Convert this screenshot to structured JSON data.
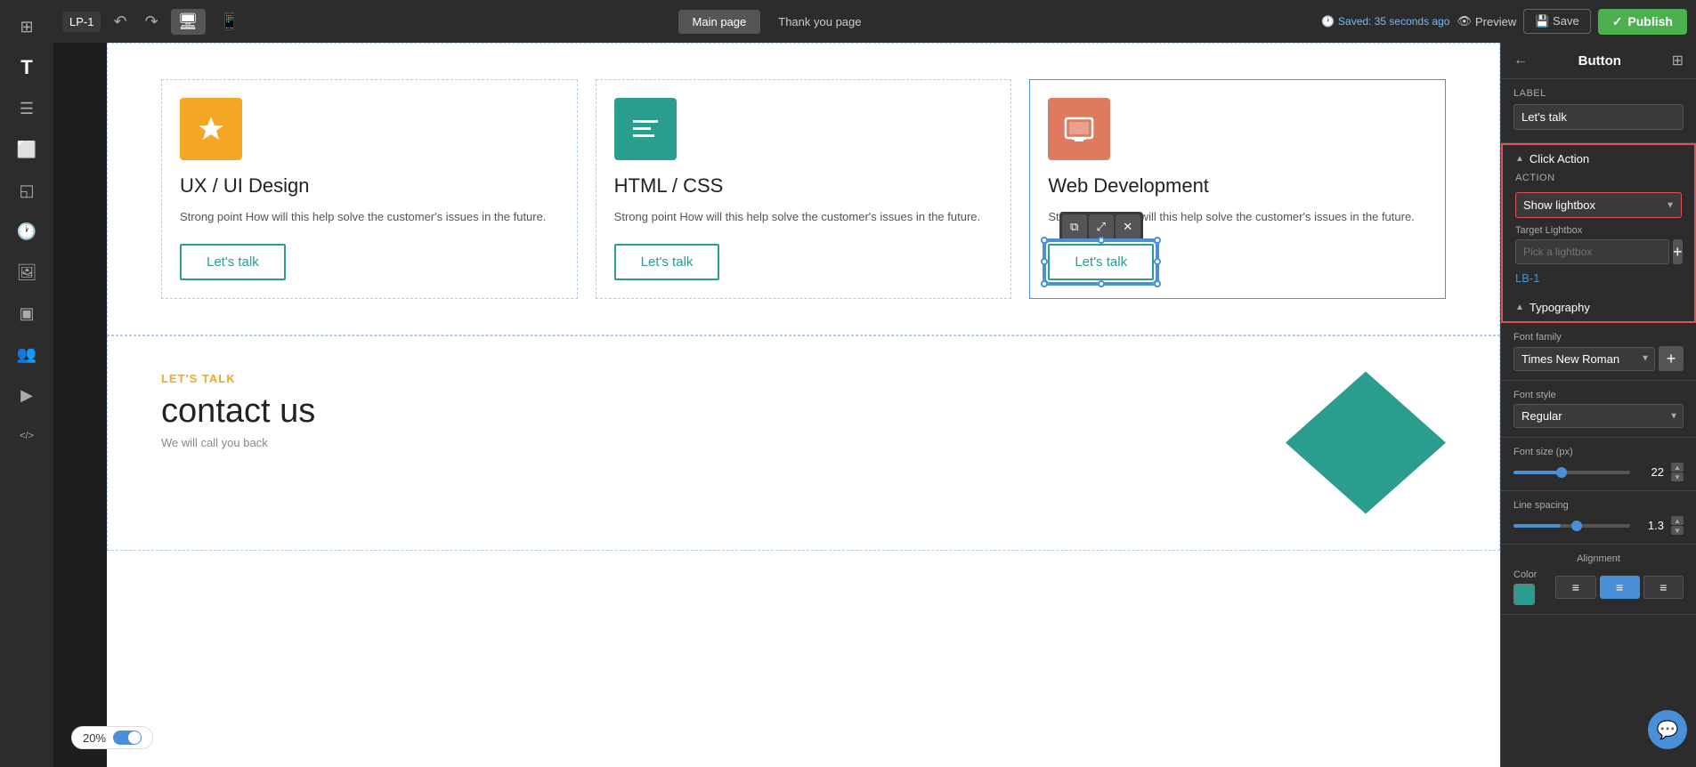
{
  "topbar": {
    "project_name": "LP-1",
    "undo_label": "↺",
    "redo_label": "↻",
    "desktop_icon": "🖥",
    "mobile_icon": "📱",
    "pages": [
      {
        "label": "Main page",
        "active": true
      },
      {
        "label": "Thank you page",
        "active": false
      }
    ],
    "saved_text": "Saved: 35 seconds ago",
    "preview_label": "Preview",
    "save_label": "Save",
    "publish_label": "Publish"
  },
  "left_sidebar": {
    "icons": [
      {
        "name": "home-icon",
        "symbol": "⊞"
      },
      {
        "name": "text-icon",
        "symbol": "T"
      },
      {
        "name": "rows-icon",
        "symbol": "☰"
      },
      {
        "name": "widget-icon",
        "symbol": "⬜"
      },
      {
        "name": "shape-icon",
        "symbol": "◱"
      },
      {
        "name": "clock-icon",
        "symbol": "🕐"
      },
      {
        "name": "image-icon",
        "symbol": "🖼"
      },
      {
        "name": "section-icon",
        "symbol": "▣"
      },
      {
        "name": "team-icon",
        "symbol": "👥"
      },
      {
        "name": "video-icon",
        "symbol": "▶"
      },
      {
        "name": "code-icon",
        "symbol": "</>"
      }
    ]
  },
  "canvas": {
    "services": [
      {
        "icon_symbol": "✦",
        "icon_color": "orange",
        "title": "UX / UI Design",
        "description": "Strong point How will this help solve the customer's issues in the future.",
        "button_label": "Let's talk",
        "selected": false
      },
      {
        "icon_symbol": "⌨",
        "icon_color": "teal",
        "title": "HTML / CSS",
        "description": "Strong point How will this help solve the customer's issues in the future.",
        "button_label": "Let's talk",
        "selected": false
      },
      {
        "icon_symbol": "🖥",
        "icon_color": "salmon",
        "title": "Web Development",
        "description": "Strong point How will this help solve the customer's issues in the future.",
        "button_label": "Let's talk",
        "selected": true
      }
    ],
    "contact": {
      "label": "LET'S TALK",
      "title": "contact us",
      "subtitle": "We will call you back"
    }
  },
  "zoom": {
    "value": "20%"
  },
  "right_panel": {
    "title": "Button",
    "label_section": {
      "label": "Label",
      "value": "Let's talk"
    },
    "click_action": {
      "section_title": "Click Action",
      "action_label": "Action",
      "action_value": "Show lightbox",
      "target_lightbox_label": "Target Lightbox",
      "target_lightbox_placeholder": "Pick a lightbox",
      "lightbox_items": [
        "LB-1"
      ]
    },
    "typography": {
      "section_title": "Typography",
      "font_family_label": "Font family",
      "font_family_value": "Times New Roman",
      "font_style_label": "Font style",
      "font_style_value": "Regular",
      "font_size_label": "Font size (px)",
      "font_size_value": 22,
      "font_size_percent": 40,
      "line_spacing_label": "Line spacing",
      "line_spacing_value": 1.3,
      "line_spacing_percent": 55,
      "alignment_label": "Alignment",
      "color_label": "Color",
      "color_value": "#2a9d8f",
      "align_options": [
        "left",
        "center",
        "right"
      ]
    }
  }
}
